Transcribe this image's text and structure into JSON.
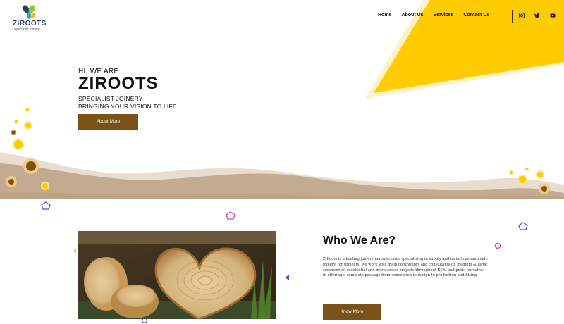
{
  "header": {
    "logo": {
      "brand": "ZiROOTS",
      "tagline": "specialist joinery"
    },
    "nav": [
      "Home",
      "About Us",
      "Services",
      "Contact Us"
    ],
    "social_icons": [
      "instagram-icon",
      "twitter-icon",
      "youtube-icon"
    ]
  },
  "hero": {
    "greeting": "HI, WE ARE",
    "title": "ZIROOTS",
    "subtitle_line1": "SPECIALIST JOINERY",
    "subtitle_line2": "BRINGING YOUR VISION TO LIFE...",
    "button": "About More"
  },
  "who": {
    "title": "Who We Are?",
    "text": "ZiRoots is a leading joinery manufacturer specialising in supply and install custom made joinery, for projects. We work with main contractors and consultants on medium & large commercial, residential and more sector projects throughout KSA, and pride ourselves in offering a complete package from conception to design to production and fitting.",
    "button": "Know More"
  },
  "colors": {
    "accent_yellow": "#ffcc00",
    "brown": "#7b5215",
    "wave": "#c2ab8e"
  }
}
